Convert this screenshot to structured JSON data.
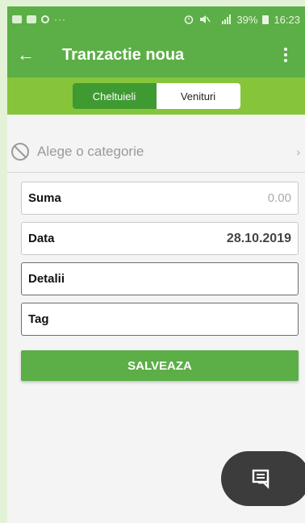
{
  "status_bar": {
    "battery": "39%",
    "time": "16:23"
  },
  "app_bar": {
    "title": "Tranzactie noua"
  },
  "tabs": [
    {
      "label": "Cheltuieli",
      "active": true
    },
    {
      "label": "Venituri",
      "active": false
    }
  ],
  "category": {
    "placeholder": "Alege o categorie"
  },
  "fields": [
    {
      "label": "Suma",
      "value": "0.00"
    },
    {
      "label": "Data",
      "value": "28.10.2019"
    },
    {
      "label": "Detalii",
      "value": ""
    },
    {
      "label": "Tag",
      "value": ""
    }
  ],
  "save_button": {
    "label": "SALVEAZA"
  },
  "colors": {
    "primary": "#5cae47",
    "tab_bar": "#86c53a",
    "active_tab": "#3f9a32",
    "fab": "#3c3c3c"
  }
}
